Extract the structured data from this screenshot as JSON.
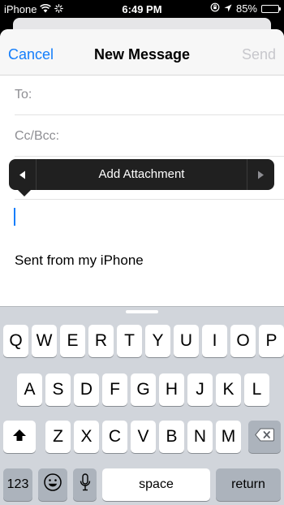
{
  "status_bar": {
    "carrier": "iPhone",
    "time": "6:49 PM",
    "battery_percent": "85%",
    "battery_level": 0.85,
    "battery_color": "#4cd964",
    "icons": [
      "wifi-icon",
      "activity-spinner-icon",
      "orientation-lock-icon",
      "location-arrow-icon",
      "battery-icon"
    ]
  },
  "nav": {
    "cancel_label": "Cancel",
    "title": "New Message",
    "send_label": "Send"
  },
  "fields": {
    "to_label": "To:",
    "cc_bcc_label": "Cc/Bcc:"
  },
  "popover": {
    "label": "Add Attachment",
    "left_icon": "triangle-left-icon",
    "right_icon": "triangle-right-icon"
  },
  "body": {
    "signature": "Sent from my iPhone"
  },
  "keyboard": {
    "row1": [
      "Q",
      "W",
      "E",
      "R",
      "T",
      "Y",
      "U",
      "I",
      "O",
      "P"
    ],
    "row2": [
      "A",
      "S",
      "D",
      "F",
      "G",
      "H",
      "J",
      "K",
      "L"
    ],
    "row3": [
      "Z",
      "X",
      "C",
      "V",
      "B",
      "N",
      "M"
    ],
    "shift_icon": "shift-arrow-icon",
    "delete_icon": "backspace-icon",
    "numbers_label": "123",
    "emoji_icon": "emoji-icon",
    "mic_icon": "microphone-icon",
    "space_label": "space",
    "return_label": "return"
  },
  "colors": {
    "accent": "#147efb",
    "disabled": "#c7c7cc",
    "keyboard_bg": "#d1d5db",
    "popover_bg": "#202020"
  }
}
